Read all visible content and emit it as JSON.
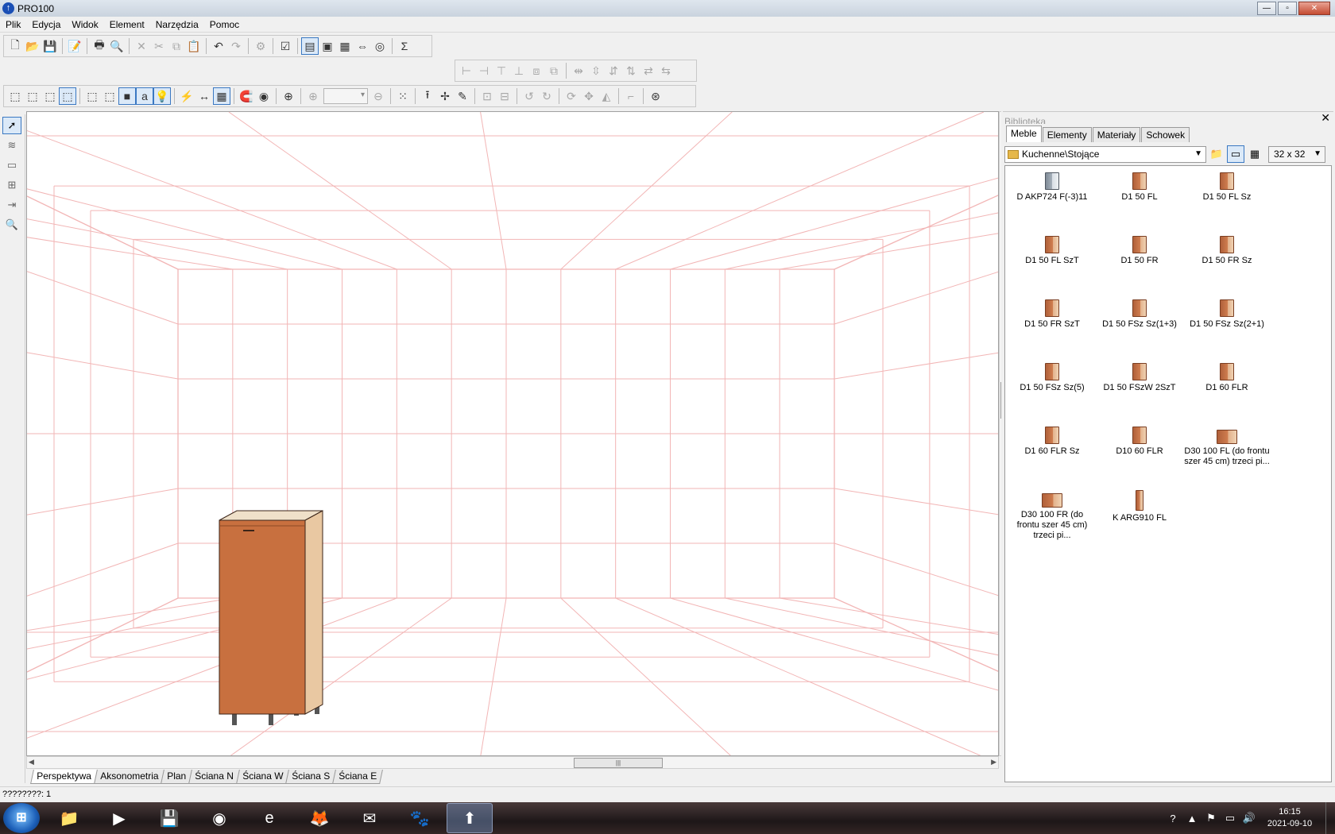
{
  "window": {
    "title": "PRO100",
    "minimize": "—",
    "maximize": "▫",
    "close": "✕"
  },
  "menu": [
    "Plik",
    "Edycja",
    "Widok",
    "Element",
    "Narzędzia",
    "Pomoc"
  ],
  "left_tools": [
    "select-arrow",
    "move-walls",
    "draw-rect",
    "align",
    "distribute",
    "zoom"
  ],
  "viewport": {
    "grid_color": "#f2b5b5"
  },
  "cabinet": {
    "front_color": "#c8703f",
    "side_color": "#e9c8a2"
  },
  "view_tabs": [
    "Perspektywa",
    "Aksonometria",
    "Plan",
    "Ściana N",
    "Ściana W",
    "Ściana S",
    "Ściana E"
  ],
  "library": {
    "title": "Biblioteka",
    "close": "✕",
    "tabs": [
      "Meble",
      "Elementy",
      "Materiały",
      "Schowek"
    ],
    "active_tab": "Meble",
    "path": "Kuchenne\\Stojące",
    "icon_size": "32 x  32",
    "items": [
      {
        "label": "D AKP724 F(-3)11",
        "kind": "appliance"
      },
      {
        "label": "D1 50 FL",
        "kind": "cabinet"
      },
      {
        "label": "D1 50 FL Sz",
        "kind": "cabinet"
      },
      {
        "label": "D1 50 FL SzT",
        "kind": "cabinet"
      },
      {
        "label": "D1 50 FR",
        "kind": "cabinet"
      },
      {
        "label": "D1 50 FR Sz",
        "kind": "cabinet"
      },
      {
        "label": "D1 50 FR SzT",
        "kind": "cabinet"
      },
      {
        "label": "D1 50 FSz Sz(1+3)",
        "kind": "cabinet"
      },
      {
        "label": "D1 50 FSz Sz(2+1)",
        "kind": "cabinet"
      },
      {
        "label": "D1 50 FSz Sz(5)",
        "kind": "cabinet"
      },
      {
        "label": "D1 50 FSzW 2SzT",
        "kind": "cabinet"
      },
      {
        "label": "D1 60 FLR",
        "kind": "cabinet"
      },
      {
        "label": "D1 60 FLR Sz",
        "kind": "cabinet"
      },
      {
        "label": "D10 60 FLR",
        "kind": "cabinet"
      },
      {
        "label": "D30 100 FL (do frontu szer 45 cm) trzeci pi...",
        "kind": "wide"
      },
      {
        "label": "D30 100 FR (do frontu szer 45 cm) trzeci pi...",
        "kind": "wide"
      },
      {
        "label": "K ARG910 FL",
        "kind": "tall"
      }
    ]
  },
  "status": "????????: 1",
  "taskbar": {
    "start": "⊞",
    "apps": [
      {
        "name": "file-explorer",
        "glyph": "📁"
      },
      {
        "name": "media-player",
        "glyph": "▶"
      },
      {
        "name": "save-app",
        "glyph": "💾"
      },
      {
        "name": "chrome",
        "glyph": "◉"
      },
      {
        "name": "internet-explorer",
        "glyph": "e"
      },
      {
        "name": "firefox",
        "glyph": "🦊"
      },
      {
        "name": "mail",
        "glyph": "✉"
      },
      {
        "name": "gimp",
        "glyph": "🐾"
      },
      {
        "name": "pro100",
        "glyph": "⬆",
        "active": true
      }
    ],
    "clock_time": "16:15",
    "clock_date": "2021-09-10"
  }
}
